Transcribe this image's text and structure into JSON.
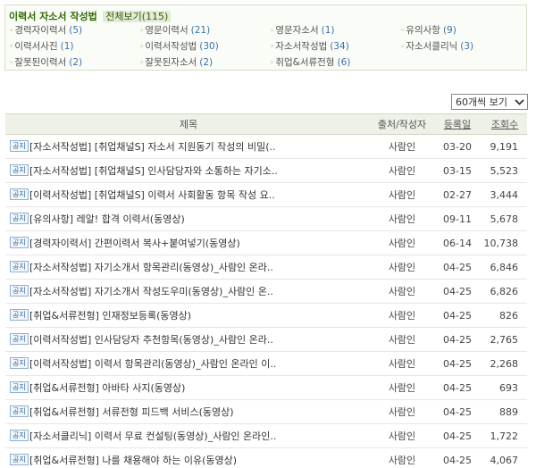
{
  "category_box": {
    "title": "이력서 자소서 작성법",
    "view_all": "전체보기(115)",
    "items": [
      {
        "name": "경력자이력서",
        "count": "(5)"
      },
      {
        "name": "영문이력서",
        "count": "(21)"
      },
      {
        "name": "영문자소서",
        "count": "(1)"
      },
      {
        "name": "유의사항",
        "count": "(9)"
      },
      {
        "name": "이력서사진",
        "count": "(1)"
      },
      {
        "name": "이력서작성법",
        "count": "(30)"
      },
      {
        "name": "자소서작성법",
        "count": "(34)"
      },
      {
        "name": "자소서클리닉",
        "count": "(3)"
      },
      {
        "name": "잘못된이력서",
        "count": "(2)"
      },
      {
        "name": "잘못된자소서",
        "count": "(2)"
      },
      {
        "name": "취업&서류전형",
        "count": "(6)"
      }
    ]
  },
  "view_select": {
    "value": "60개씩 보기"
  },
  "table": {
    "headers": {
      "title": "제목",
      "author": "출처/작성자",
      "date": "등록일",
      "views": "조회수"
    },
    "badge": "공지",
    "rows": [
      {
        "title": "[자소서작성법] [취업채널S] 자소서 지원동기 작성의 비밀(..",
        "author": "사람인",
        "date": "03-20",
        "views": "9,191"
      },
      {
        "title": "[자소서작성법] [취업채널S] 인사담당자와 소통하는 자기소..",
        "author": "사람인",
        "date": "03-15",
        "views": "5,523"
      },
      {
        "title": "[이력서작성법] [취업채널S] 이력서 사회활동 항목 작성 요..",
        "author": "사람인",
        "date": "02-27",
        "views": "3,444"
      },
      {
        "title": "[유의사항] 레알! 합격 이력서(동영상)",
        "author": "사람인",
        "date": "09-11",
        "views": "5,678"
      },
      {
        "title": "[경력자이력서] 간편이력서 복사+붙여넣기(동영상)",
        "author": "사람인",
        "date": "06-14",
        "views": "10,738"
      },
      {
        "title": "[자소서작성법] 자기소개서 항목관리(동영상)_사람인 온라..",
        "author": "사람인",
        "date": "04-25",
        "views": "6,846"
      },
      {
        "title": "[자소서작성법] 자기소개서 작성도우미(동영상)_사람인 온..",
        "author": "사람인",
        "date": "04-25",
        "views": "6,826"
      },
      {
        "title": "[취업&서류전형] 인재정보등록(동영상)",
        "author": "사람인",
        "date": "04-25",
        "views": "826"
      },
      {
        "title": "[이력서작성법] 인사담당자 추천항목(동영상)_사람인 온라..",
        "author": "사람인",
        "date": "04-25",
        "views": "2,765"
      },
      {
        "title": "[이력서작성법] 이력서 항목관리(동영상)_사람인 온라인 이..",
        "author": "사람인",
        "date": "04-25",
        "views": "2,268"
      },
      {
        "title": "[취업&서류전형] 아바타 사지(동영상)",
        "author": "사람인",
        "date": "04-25",
        "views": "693"
      },
      {
        "title": "[취업&서류전형] 서류전형 피드백 서비스(동영상)",
        "author": "사람인",
        "date": "04-25",
        "views": "889"
      },
      {
        "title": "[자소서클리닉] 이력서 무료 컨설팅(동영상)_사람인 온라인..",
        "author": "사람인",
        "date": "04-25",
        "views": "1,722"
      },
      {
        "title": "[취업&서류전형] 나를 채용해야 하는 이유(동영상)",
        "author": "사람인",
        "date": "04-25",
        "views": "4,067"
      }
    ]
  }
}
